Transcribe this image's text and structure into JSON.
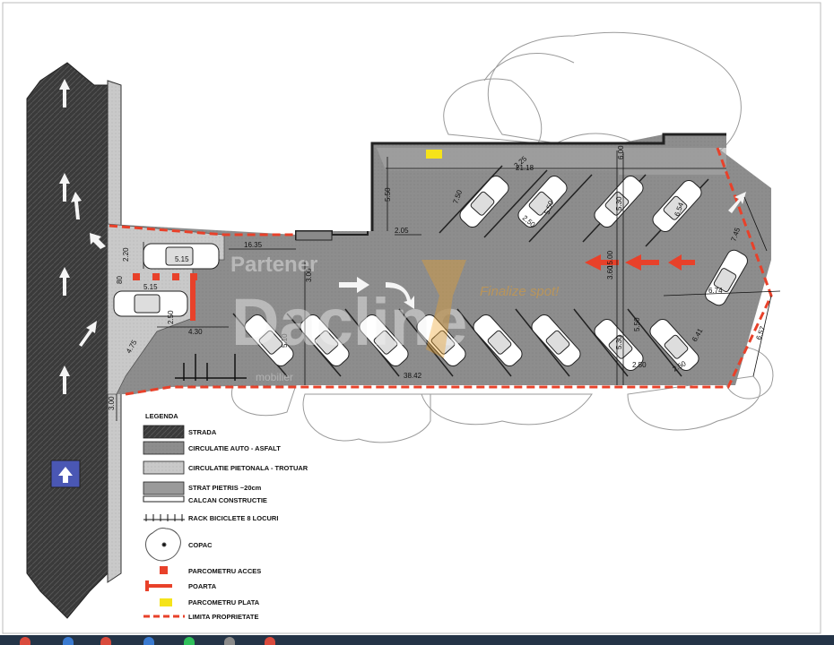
{
  "legend": {
    "title": "LEGENDA",
    "items": [
      {
        "label": "STRADA"
      },
      {
        "label": "CIRCULATIE AUTO - ASFALT"
      },
      {
        "label": "CIRCULATIE PIETONALA - TROTUAR"
      },
      {
        "label": "STRAT PIETRIS ~20cm"
      },
      {
        "label": "CALCAN CONSTRUCTIE"
      },
      {
        "label": "RACK BICICLETE 8 LOCURI"
      },
      {
        "label": "COPAC"
      },
      {
        "label": "PARCOMETRU ACCES"
      },
      {
        "label": "POARTA"
      },
      {
        "label": "PARCOMETRU PLATA"
      },
      {
        "label": "LIMITA PROPRIETATE"
      }
    ]
  },
  "dimensions": {
    "d_21_18": "21.18",
    "d_2_25": "2.25",
    "d_6_00": "6.00",
    "d_5_50_top": "5.50",
    "d_7_50": "7.50",
    "d_5_30_a": "5.30",
    "d_5_30_b": "5.30",
    "d_2_50_a": "2.50",
    "d_2_50_b": "2.50",
    "d_2_50_c": "2.50",
    "d_2_50_d": "2.50",
    "d_5_50_r": "5.50",
    "d_6_54": "6.54",
    "d_2_05": "2.05",
    "d_16_35": "16.35",
    "d_3_60": "3.60",
    "d_15_00": "15.00",
    "d_7_45": "7.45",
    "d_6_74": "6.74",
    "d_6_41": "6.41",
    "d_6_57": "6.57",
    "d_5_15_a": "5.15",
    "d_5_15_b": "5.15",
    "d_2_20": "2.20",
    "d_80": "80",
    "d_4_30": "4.30",
    "d_4_75": "4.75",
    "d_5_10": "5.10",
    "d_38_42": "38.42",
    "d_3_00": "3.00",
    "d_5_50_c": "5.50"
  },
  "watermark": {
    "line1": "Partener",
    "line2": "Dacline",
    "tagline": "Finalize spot!",
    "footer": "mobilier"
  },
  "colors": {
    "street": "#3a3a3a",
    "asphalt": "#8a8a8a",
    "sidewalk": "#c8c8c8",
    "gravel": "#a9a9a9",
    "boundary": "#e8412a",
    "arrow_red": "#e8412a",
    "parcometru_plata": "#f5e31a",
    "accent_blue": "#4a57b4",
    "taskbar": "#243447"
  }
}
